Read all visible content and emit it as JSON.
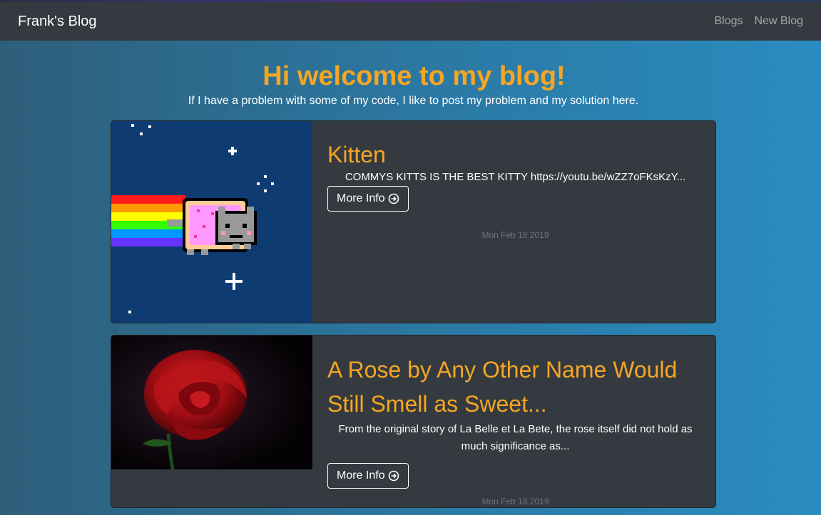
{
  "navbar": {
    "brand": "Frank's Blog",
    "links": [
      "Blogs",
      "New Blog"
    ]
  },
  "hero": {
    "title": "Hi welcome to my blog!",
    "subtitle": "If I have a problem with some of my code, I like to post my problem and my solution here."
  },
  "posts": [
    {
      "title": "Kitten",
      "excerpt": "COMMYS KITTS IS THE BEST KITTY https://youtu.be/wZZ7oFKsKzY...",
      "button": "More Info",
      "date": "Mon Feb 18 2019",
      "image": "nyan-cat-pixel-art"
    },
    {
      "title": "A Rose by Any Other Name Would Still Smell as Sweet...",
      "excerpt": "From the original story of La Belle et La Bete, the rose itself did not hold as much significance as...",
      "button": "More Info",
      "date": "Mon Feb 18 2019",
      "image": "red-rose-photo"
    }
  ],
  "colors": {
    "accent": "#f5a623",
    "navbar": "#343a40",
    "card": "#343a40",
    "muted": "#6c757d"
  }
}
